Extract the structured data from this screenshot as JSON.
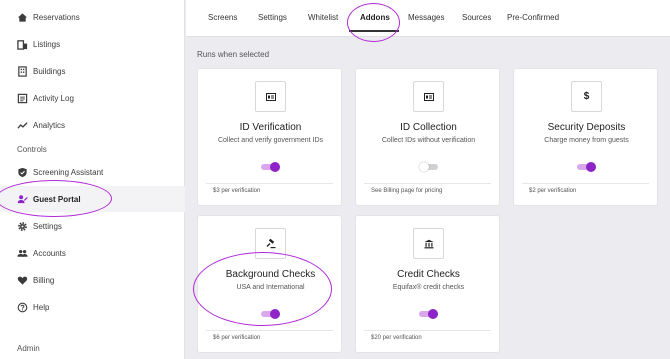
{
  "sidebar": {
    "items": [
      {
        "label": "Reservations",
        "icon": "home-icon"
      },
      {
        "label": "Listings",
        "icon": "listings-icon"
      },
      {
        "label": "Buildings",
        "icon": "building-icon"
      },
      {
        "label": "Activity Log",
        "icon": "log-icon"
      },
      {
        "label": "Analytics",
        "icon": "analytics-icon"
      }
    ],
    "controls_label": "Controls",
    "control_items": [
      {
        "label": "Screening Assistant",
        "icon": "shield-icon"
      },
      {
        "label": "Guest Portal",
        "icon": "guest-icon",
        "active": true
      },
      {
        "label": "Settings",
        "icon": "gear-icon"
      },
      {
        "label": "Accounts",
        "icon": "accounts-icon"
      },
      {
        "label": "Billing",
        "icon": "heart-icon"
      },
      {
        "label": "Help",
        "icon": "help-icon"
      }
    ],
    "admin_label": "Admin"
  },
  "tabs": [
    "Screens",
    "Settings",
    "Whitelist",
    "Addons",
    "Messages",
    "Sources",
    "Pre-Confirmed"
  ],
  "active_tab": "Addons",
  "runs_label": "Runs when selected",
  "cards": [
    {
      "title": "ID Verification",
      "description": "Collect and verify government IDs",
      "footer": "$3 per verification",
      "enabled": true,
      "icon": "id-card-icon"
    },
    {
      "title": "ID Collection",
      "description": "Collect IDs without verification",
      "footer": "See Billing page for pricing",
      "enabled": false,
      "icon": "id-card-icon"
    },
    {
      "title": "Security Deposits",
      "description": "Charge money from guests",
      "footer": "$2 per verification",
      "enabled": true,
      "icon": "dollar-icon"
    },
    {
      "title": "Background Checks",
      "description": "USA and International",
      "footer": "$6 per verification",
      "enabled": true,
      "icon": "gavel-icon"
    },
    {
      "title": "Credit Checks",
      "description": "Equifax® credit checks",
      "footer": "$20 per verification",
      "enabled": true,
      "icon": "bank-icon"
    }
  ],
  "colors": {
    "accent": "#8e24c8",
    "annotation": "#b12ad8"
  }
}
